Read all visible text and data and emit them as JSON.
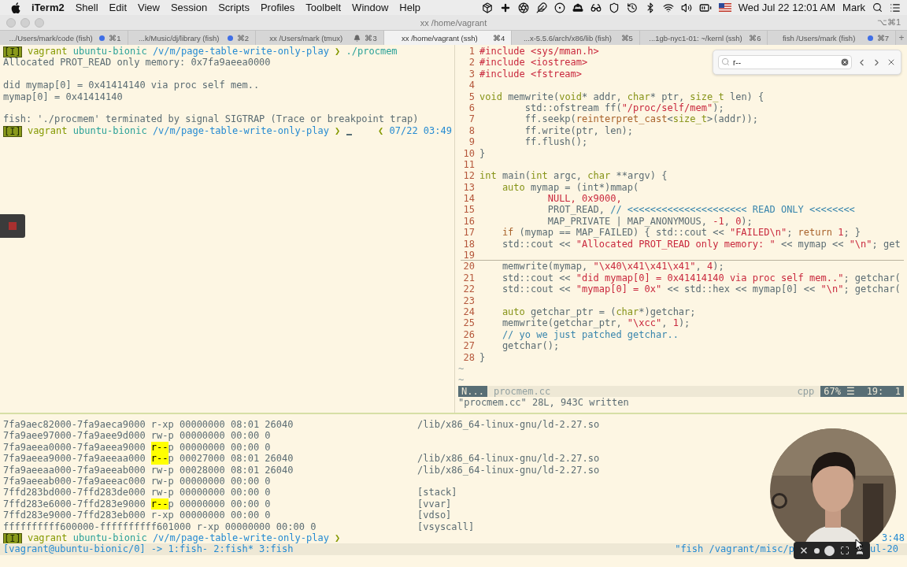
{
  "menu_bar": {
    "app": "iTerm2",
    "menus": [
      "Shell",
      "Edit",
      "View",
      "Session",
      "Scripts",
      "Profiles",
      "Toolbelt",
      "Window",
      "Help"
    ],
    "clock": "Wed Jul 22  12:01 AM",
    "user": "Mark"
  },
  "window": {
    "title": "xx /home/vagrant",
    "shortcut": "⌥⌘1"
  },
  "tabs": [
    {
      "label": ".../Users/mark/code (fish)",
      "kind": "dot",
      "shortcut": "⌘1",
      "selected": false
    },
    {
      "label": "...k/Music/dj/library (fish)",
      "kind": "dot",
      "shortcut": "⌘2",
      "selected": false
    },
    {
      "label": "xx /Users/mark (tmux)",
      "kind": "bell",
      "shortcut": "⌘3",
      "selected": false
    },
    {
      "label": "xx /home/vagrant (ssh)",
      "kind": "plain",
      "shortcut": "⌘4",
      "selected": true
    },
    {
      "label": "...x-5.5.6/arch/x86/lib (fish)",
      "kind": "plain",
      "shortcut": "⌘5",
      "selected": false
    },
    {
      "label": "...1gb-nyc1-01: ~/kernl (ssh)",
      "kind": "plain",
      "shortcut": "⌘6",
      "selected": false
    },
    {
      "label": "fish /Users/mark (fish)",
      "kind": "dot",
      "shortcut": "⌘7",
      "selected": false
    }
  ],
  "new_tab": "+",
  "left_pane": {
    "lines": [
      {
        "kind": "prompt",
        "mode": "[I]",
        "user": "vagrant",
        "host": "ubuntu-bionic",
        "path": "/v/m/page-table-write-only-play",
        "symbol": "❯",
        "command": "./procmem",
        "cursor": false
      },
      {
        "kind": "output",
        "text": "Allocated PROT_READ only memory: 0x7fa9aeea0000"
      },
      {
        "kind": "blank"
      },
      {
        "kind": "output",
        "text": "did mymap[0] = 0x41414140 via proc self mem.."
      },
      {
        "kind": "output",
        "text": "mymap[0] = 0x41414140"
      },
      {
        "kind": "blank"
      },
      {
        "kind": "output",
        "text": "fish: './procmem' terminated by signal SIGTRAP (Trace or breakpoint trap)"
      },
      {
        "kind": "prompt",
        "mode": "[I]",
        "user": "vagrant",
        "host": "ubuntu-bionic",
        "path": "/v/m/page-table-write-only-play",
        "symbol": "❯",
        "cursor": true,
        "right_symbol": "❮",
        "right_time": "07/22 03:49"
      }
    ]
  },
  "editor": {
    "lines": [
      {
        "number": "1",
        "cursor": false,
        "tokens": [
          {
            "kind": "pre",
            "text": "#include <sys/mman.h>"
          }
        ]
      },
      {
        "number": "2",
        "cursor": false,
        "tokens": [
          {
            "kind": "pre",
            "text": "#include <iostream>"
          }
        ]
      },
      {
        "number": "3",
        "cursor": false,
        "tokens": [
          {
            "kind": "pre",
            "text": "#include <fstream>"
          }
        ]
      },
      {
        "number": "4",
        "cursor": false
      },
      {
        "number": "5",
        "cursor": false,
        "tokens": [
          {
            "kind": "type",
            "text": "void"
          },
          {
            "kind": "plain",
            "text": " memwrite("
          },
          {
            "kind": "type",
            "text": "void"
          },
          {
            "kind": "plain",
            "text": "* addr, "
          },
          {
            "kind": "type",
            "text": "char"
          },
          {
            "kind": "plain",
            "text": "* ptr, "
          },
          {
            "kind": "type",
            "text": "size_t"
          },
          {
            "kind": "plain",
            "text": " len) {"
          }
        ]
      },
      {
        "number": "6",
        "cursor": false,
        "tokens": [
          {
            "kind": "plain",
            "text": "        std::ofstream ff("
          },
          {
            "kind": "str",
            "text": "\"/proc/self/mem\""
          },
          {
            "kind": "plain",
            "text": ");"
          }
        ]
      },
      {
        "number": "7",
        "cursor": false,
        "tokens": [
          {
            "kind": "plain",
            "text": "        ff.seekp("
          },
          {
            "kind": "kw",
            "text": "reinterpret_cast"
          },
          {
            "kind": "plain",
            "text": "<"
          },
          {
            "kind": "type",
            "text": "size_t"
          },
          {
            "kind": "plain",
            "text": ">(addr));"
          }
        ]
      },
      {
        "number": "8",
        "cursor": false,
        "tokens": [
          {
            "kind": "plain",
            "text": "        ff.write(ptr, len);"
          }
        ]
      },
      {
        "number": "9",
        "cursor": false,
        "tokens": [
          {
            "kind": "plain",
            "text": "        ff.flush();"
          }
        ]
      },
      {
        "number": "10",
        "cursor": false,
        "tokens": [
          {
            "kind": "plain",
            "text": "}"
          }
        ]
      },
      {
        "number": "11",
        "cursor": false
      },
      {
        "number": "12",
        "cursor": false,
        "tokens": [
          {
            "kind": "type",
            "text": "int"
          },
          {
            "kind": "plain",
            "text": " main("
          },
          {
            "kind": "type",
            "text": "int"
          },
          {
            "kind": "plain",
            "text": " argc, "
          },
          {
            "kind": "type",
            "text": "char"
          },
          {
            "kind": "plain",
            "text": " **argv) {"
          }
        ]
      },
      {
        "number": "13",
        "cursor": false,
        "tokens": [
          {
            "kind": "type",
            "text": "    auto"
          },
          {
            "kind": "plain",
            "text": " mymap = (int*)mmap("
          }
        ]
      },
      {
        "number": "14",
        "cursor": false,
        "tokens": [
          {
            "kind": "num",
            "text": "            NULL, 0x9000,"
          }
        ]
      },
      {
        "number": "15",
        "cursor": false,
        "tokens": [
          {
            "kind": "plain",
            "text": "            PROT_READ, "
          },
          {
            "kind": "cmt",
            "text": "// <<<<<<<<<<<<<<<<<<<<< READ ONLY <<<<<<<<"
          }
        ]
      },
      {
        "number": "16",
        "cursor": false,
        "tokens": [
          {
            "kind": "plain",
            "text": "            MAP_PRIVATE | MAP_ANONYMOUS, "
          },
          {
            "kind": "num",
            "text": "-1"
          },
          {
            "kind": "plain",
            "text": ", "
          },
          {
            "kind": "num",
            "text": "0"
          },
          {
            "kind": "plain",
            "text": ");"
          }
        ]
      },
      {
        "number": "17",
        "cursor": false,
        "tokens": [
          {
            "kind": "kw",
            "text": "    if"
          },
          {
            "kind": "plain",
            "text": " (mymap == MAP_FAILED) { std::cout << "
          },
          {
            "kind": "str",
            "text": "\"FAILED\\n\""
          },
          {
            "kind": "plain",
            "text": "; "
          },
          {
            "kind": "kw",
            "text": "return "
          },
          {
            "kind": "num",
            "text": "1"
          },
          {
            "kind": "plain",
            "text": "; }"
          }
        ]
      },
      {
        "number": "18",
        "cursor": false,
        "tokens": [
          {
            "kind": "plain",
            "text": "    std::cout << "
          },
          {
            "kind": "str",
            "text": "\"Allocated PROT_READ only memory: \""
          },
          {
            "kind": "plain",
            "text": " << mymap << "
          },
          {
            "kind": "str",
            "text": "\"\\n\""
          },
          {
            "kind": "plain",
            "text": "; get"
          }
        ]
      },
      {
        "number": "19",
        "cursor": true
      },
      {
        "number": "20",
        "cursor": false,
        "tokens": [
          {
            "kind": "plain",
            "text": "    memwrite(mymap, "
          },
          {
            "kind": "str",
            "text": "\"\\x40\\x41\\x41\\x41\""
          },
          {
            "kind": "plain",
            "text": ", "
          },
          {
            "kind": "num",
            "text": "4"
          },
          {
            "kind": "plain",
            "text": ");"
          }
        ]
      },
      {
        "number": "21",
        "cursor": false,
        "tokens": [
          {
            "kind": "plain",
            "text": "    std::cout << "
          },
          {
            "kind": "str",
            "text": "\"did mymap[0] = 0x41414140 via proc self mem..\""
          },
          {
            "kind": "plain",
            "text": "; getchar("
          }
        ]
      },
      {
        "number": "22",
        "cursor": false,
        "tokens": [
          {
            "kind": "plain",
            "text": "    std::cout << "
          },
          {
            "kind": "str",
            "text": "\"mymap[0] = 0x\""
          },
          {
            "kind": "plain",
            "text": " << std::hex << mymap[0] << "
          },
          {
            "kind": "str",
            "text": "\"\\n\""
          },
          {
            "kind": "plain",
            "text": "; getchar("
          }
        ]
      },
      {
        "number": "23",
        "cursor": false
      },
      {
        "number": "24",
        "cursor": false,
        "tokens": [
          {
            "kind": "type",
            "text": "    auto"
          },
          {
            "kind": "plain",
            "text": " getchar_ptr = ("
          },
          {
            "kind": "type",
            "text": "char"
          },
          {
            "kind": "plain",
            "text": "*)getchar;"
          }
        ]
      },
      {
        "number": "25",
        "cursor": false,
        "tokens": [
          {
            "kind": "plain",
            "text": "    memwrite(getchar_ptr, "
          },
          {
            "kind": "str",
            "text": "\"\\xcc\""
          },
          {
            "kind": "plain",
            "text": ", "
          },
          {
            "kind": "num",
            "text": "1"
          },
          {
            "kind": "plain",
            "text": ");"
          }
        ]
      },
      {
        "number": "26",
        "cursor": false,
        "tokens": [
          {
            "kind": "cmt",
            "text": "    // yo we just patched getchar.."
          }
        ]
      },
      {
        "number": "27",
        "cursor": false,
        "tokens": [
          {
            "kind": "plain",
            "text": "    getchar();"
          }
        ]
      },
      {
        "number": "28",
        "cursor": false,
        "tokens": [
          {
            "kind": "plain",
            "text": "}"
          }
        ]
      }
    ],
    "tildes": [
      "~",
      "~"
    ],
    "status": {
      "mode": "N...",
      "file": "procmem.cc",
      "filetype": "cpp",
      "position": "67% ☰  19:  1"
    },
    "message": "\"procmem.cc\" 28L, 943C written"
  },
  "search": {
    "value": "r--"
  },
  "bottom_pane": {
    "maps": [
      {
        "segments": [
          {
            "text": "7fa9aec82000-7fa9aeca9000 r-xp 00000000 08:01 26040",
            "highlighted": false
          }
        ],
        "path": "/lib/x86_64-linux-gnu/ld-2.27.so"
      },
      {
        "segments": [
          {
            "text": "7fa9aee97000-7fa9aee9d000 rw-p 00000000 00:00 0",
            "highlighted": false
          }
        ]
      },
      {
        "segments": [
          {
            "text": "7fa9aeea0000-7fa9aeea9000 ",
            "highlighted": false
          },
          {
            "text": "r--",
            "highlighted": true
          },
          {
            "text": "p 00000000 00:00 0",
            "highlighted": false
          }
        ]
      },
      {
        "segments": [
          {
            "text": "7fa9aeea9000-7fa9aeeaa000 ",
            "highlighted": false
          },
          {
            "text": "r--",
            "highlighted": true
          },
          {
            "text": "p 00027000 08:01 26040",
            "highlighted": false
          }
        ],
        "path": "/lib/x86_64-linux-gnu/ld-2.27.so"
      },
      {
        "segments": [
          {
            "text": "7fa9aeeaa000-7fa9aeeab000 rw-p 00028000 08:01 26040",
            "highlighted": false
          }
        ],
        "path": "/lib/x86_64-linux-gnu/ld-2.27.so"
      },
      {
        "segments": [
          {
            "text": "7fa9aeeab000-7fa9aeeac000 rw-p 00000000 00:00 0",
            "highlighted": false
          }
        ]
      },
      {
        "segments": [
          {
            "text": "7ffd283bd000-7ffd283de000 rw-p 00000000 00:00 0",
            "highlighted": false
          }
        ],
        "path": "[stack]"
      },
      {
        "segments": [
          {
            "text": "7ffd283e6000-7ffd283e9000 ",
            "highlighted": false
          },
          {
            "text": "r--",
            "highlighted": true
          },
          {
            "text": "p 00000000 00:00 0",
            "highlighted": false
          }
        ],
        "path": "[vvar]"
      },
      {
        "segments": [
          {
            "text": "7ffd283e9000-7ffd283eb000 r-xp 00000000 00:00 0",
            "highlighted": false
          }
        ],
        "path": "[vdso]"
      },
      {
        "segments": [
          {
            "text": "ffffffffff600000-ffffffffff601000 r-xp 00000000 00:00 0",
            "highlighted": false
          }
        ],
        "path": "[vsyscall]"
      }
    ],
    "prompt": {
      "mode": "[I]",
      "user": "vagrant",
      "host": "ubuntu-bionic",
      "path": "/v/m/page-table-write-only-play",
      "symbol": "❯",
      "cursor": false,
      "right_time": "3:48"
    }
  },
  "tmux_status": {
    "left": "[vagrant@ubuntu-bionic/0] -> 1:fish- 2:fish* 3:fish",
    "right_start": "\"fish /vagrant/misc/p",
    "right_end": "ul-20"
  }
}
